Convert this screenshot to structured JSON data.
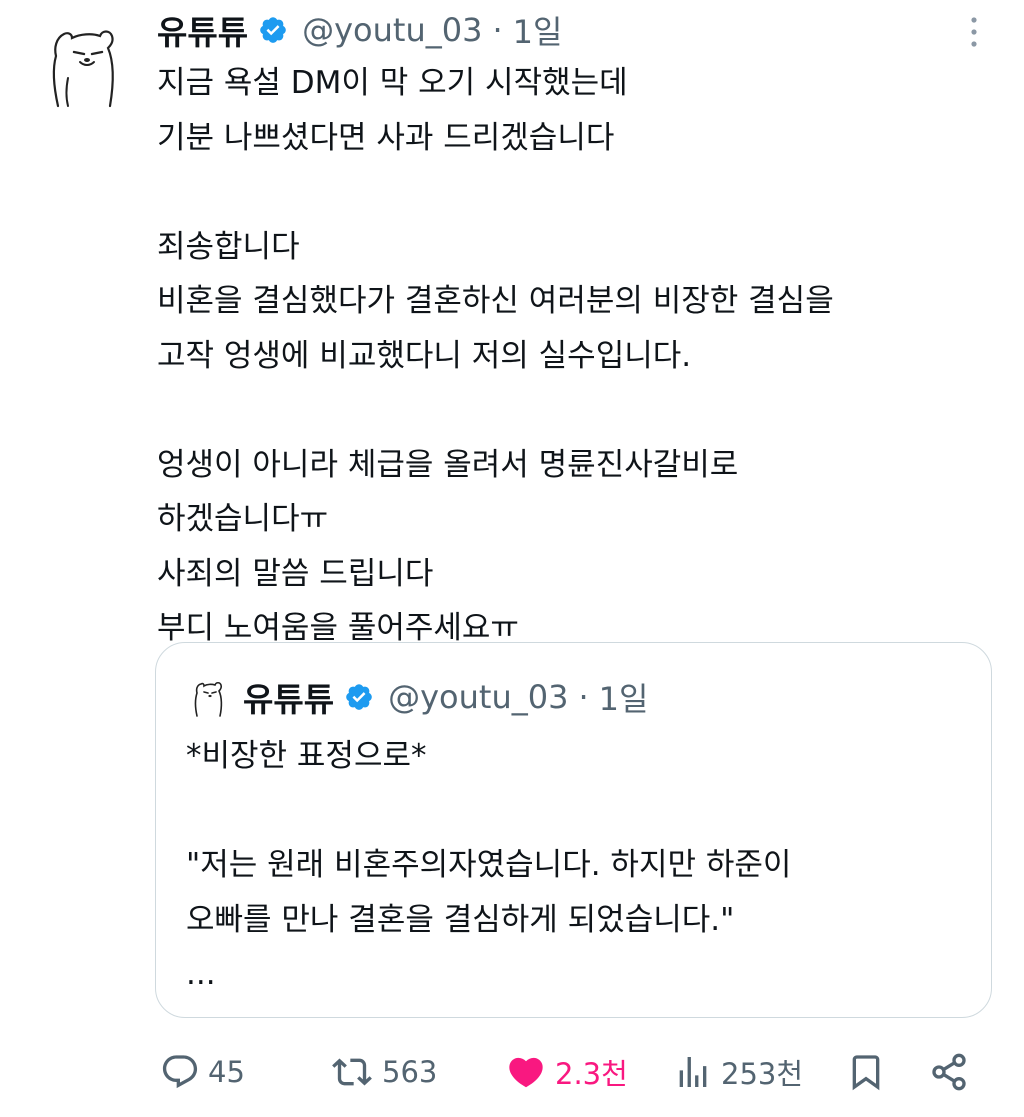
{
  "tweet": {
    "author": {
      "display_name": "유튜튜",
      "handle": "@youtu_03",
      "separator": "·",
      "time": "1일",
      "verified": true
    },
    "avatar_icon": "bear-avatar-icon",
    "text_lines": [
      "지금 욕설 DM이 막 오기 시작했는데",
      "기분 나쁘셨다면 사과 드리겠습니다",
      "",
      "죄송합니다",
      "비혼을 결심했다가 결혼하신 여러분의 비장한 결심을",
      "고작 엉생에 비교했다니 저의 실수입니다.",
      "",
      "엉생이 아니라 체급을 올려서 명륜진사갈비로",
      "하겠습니다ㅠ",
      "사죄의 말씀 드립니다",
      "부디 노여움을 풀어주세요ㅠ"
    ]
  },
  "quote": {
    "author": {
      "display_name": "유튜튜",
      "handle": "@youtu_03",
      "separator": "·",
      "time": "1일"
    },
    "text_lines": [
      "*비장한 표정으로*",
      "",
      "\"저는 원래 비혼주의자였습니다. 하지만 하준이",
      "오빠를 만나 결혼을 결심하게 되었습니다.\"",
      "..."
    ]
  },
  "actions": {
    "reply": {
      "icon": "reply-icon",
      "count": "45"
    },
    "retweet": {
      "icon": "retweet-icon",
      "count": "563"
    },
    "like": {
      "icon": "heart-icon",
      "count": "2.3천",
      "liked": true
    },
    "views": {
      "icon": "views-icon",
      "count": "253천"
    },
    "bookmark": {
      "icon": "bookmark-icon"
    },
    "share": {
      "icon": "share-icon"
    }
  },
  "colors": {
    "text": "#0f1419",
    "secondary": "#536471",
    "verified": "#1d9bf0",
    "like": "#f91880",
    "border": "#cfd9de"
  }
}
